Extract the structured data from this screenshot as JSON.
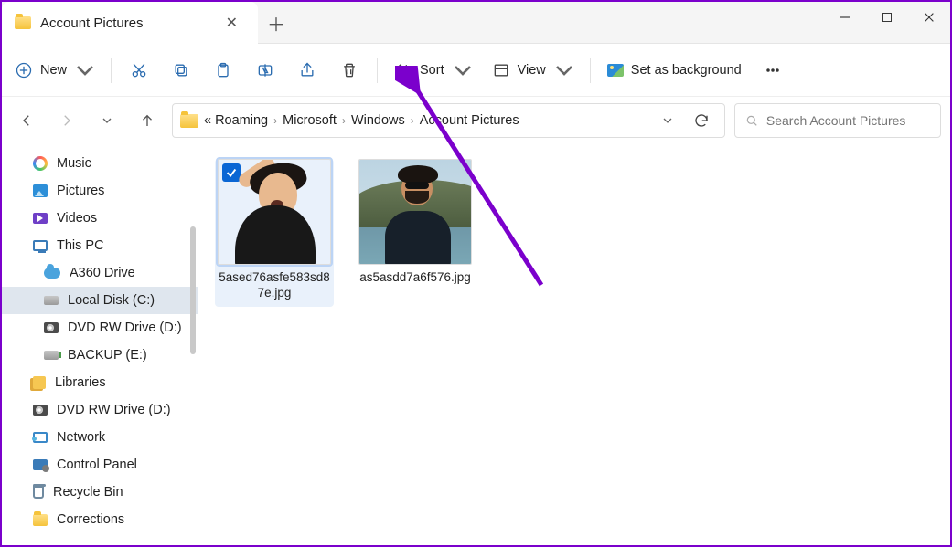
{
  "window": {
    "title": "Account Pictures"
  },
  "toolbar": {
    "new": "New",
    "sort": "Sort",
    "view": "View",
    "set_bg": "Set as background"
  },
  "breadcrumb": {
    "ellipsis": "«",
    "items": [
      "Roaming",
      "Microsoft",
      "Windows",
      "Account Pictures"
    ]
  },
  "search": {
    "placeholder": "Search Account Pictures"
  },
  "sidebar": {
    "items": [
      {
        "label": "Music",
        "icon": "music"
      },
      {
        "label": "Pictures",
        "icon": "pic"
      },
      {
        "label": "Videos",
        "icon": "vid"
      },
      {
        "label": "This PC",
        "icon": "pc"
      },
      {
        "label": "A360 Drive",
        "icon": "cloud",
        "sub": true
      },
      {
        "label": "Local Disk (C:)",
        "icon": "disk",
        "sub": true,
        "selected": true
      },
      {
        "label": "DVD RW Drive (D:)",
        "icon": "dvd",
        "sub": true
      },
      {
        "label": "BACKUP (E:)",
        "icon": "disk-usb",
        "sub": true
      },
      {
        "label": "Libraries",
        "icon": "lib"
      },
      {
        "label": "DVD RW Drive (D:)",
        "icon": "dvd"
      },
      {
        "label": "Network",
        "icon": "net"
      },
      {
        "label": "Control Panel",
        "icon": "cpl"
      },
      {
        "label": "Recycle Bin",
        "icon": "bin"
      },
      {
        "label": "Corrections",
        "icon": "folder"
      }
    ]
  },
  "files": [
    {
      "name": "5ased76asfe583sd87e.jpg",
      "selected": true
    },
    {
      "name": "as5asdd7a6f576.jpg",
      "selected": false
    }
  ],
  "annotation": {
    "arrow_target": "delete-button"
  }
}
